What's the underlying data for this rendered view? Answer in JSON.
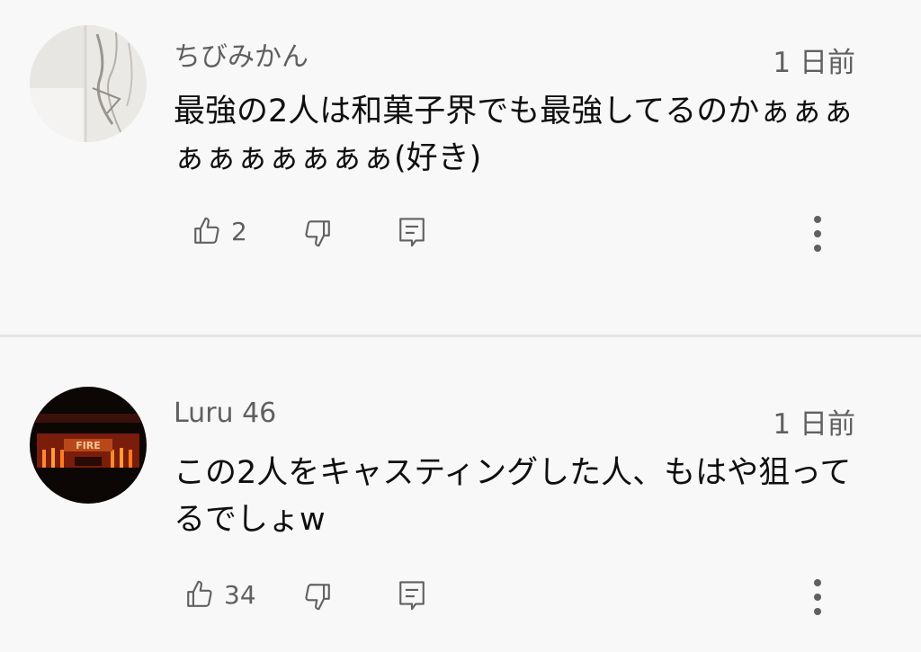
{
  "comments": [
    {
      "author": "ちびみかん",
      "time": "1 日前",
      "text": "最強の2人は和菓子界でも最強してるのかぁぁぁぁぁぁぁぁぁぁ(好き)",
      "likes": "2",
      "avatar_icon": "marble-avatar"
    },
    {
      "author": "Luru 46",
      "time": "1 日前",
      "text": "この2人をキャスティングした人、もはや狙ってるでしょw",
      "likes": "34",
      "avatar_icon": "stage-avatar"
    }
  ],
  "colors": {
    "background": "#f8f8f8",
    "divider": "#e4e4e4",
    "secondary_text": "#606060",
    "primary_text": "#0f0f0f"
  }
}
